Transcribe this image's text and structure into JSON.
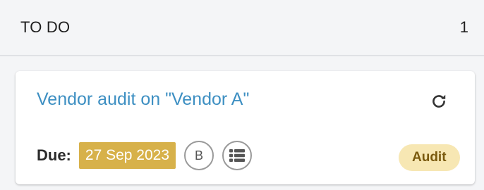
{
  "column": {
    "title": "TO DO",
    "count": "1"
  },
  "card": {
    "title": "Vendor audit on \"Vendor A\"",
    "due_label": "Due:",
    "due_date": "27 Sep 2023",
    "assignee_initial": "B",
    "badge": "Audit",
    "icons": [
      "refresh-icon",
      "list-icon"
    ],
    "colors": {
      "title": "#3d8fc2",
      "due_date_bg": "#d7b14a",
      "badge_bg": "#f7e7b3",
      "badge_text": "#7a5a0e"
    }
  }
}
